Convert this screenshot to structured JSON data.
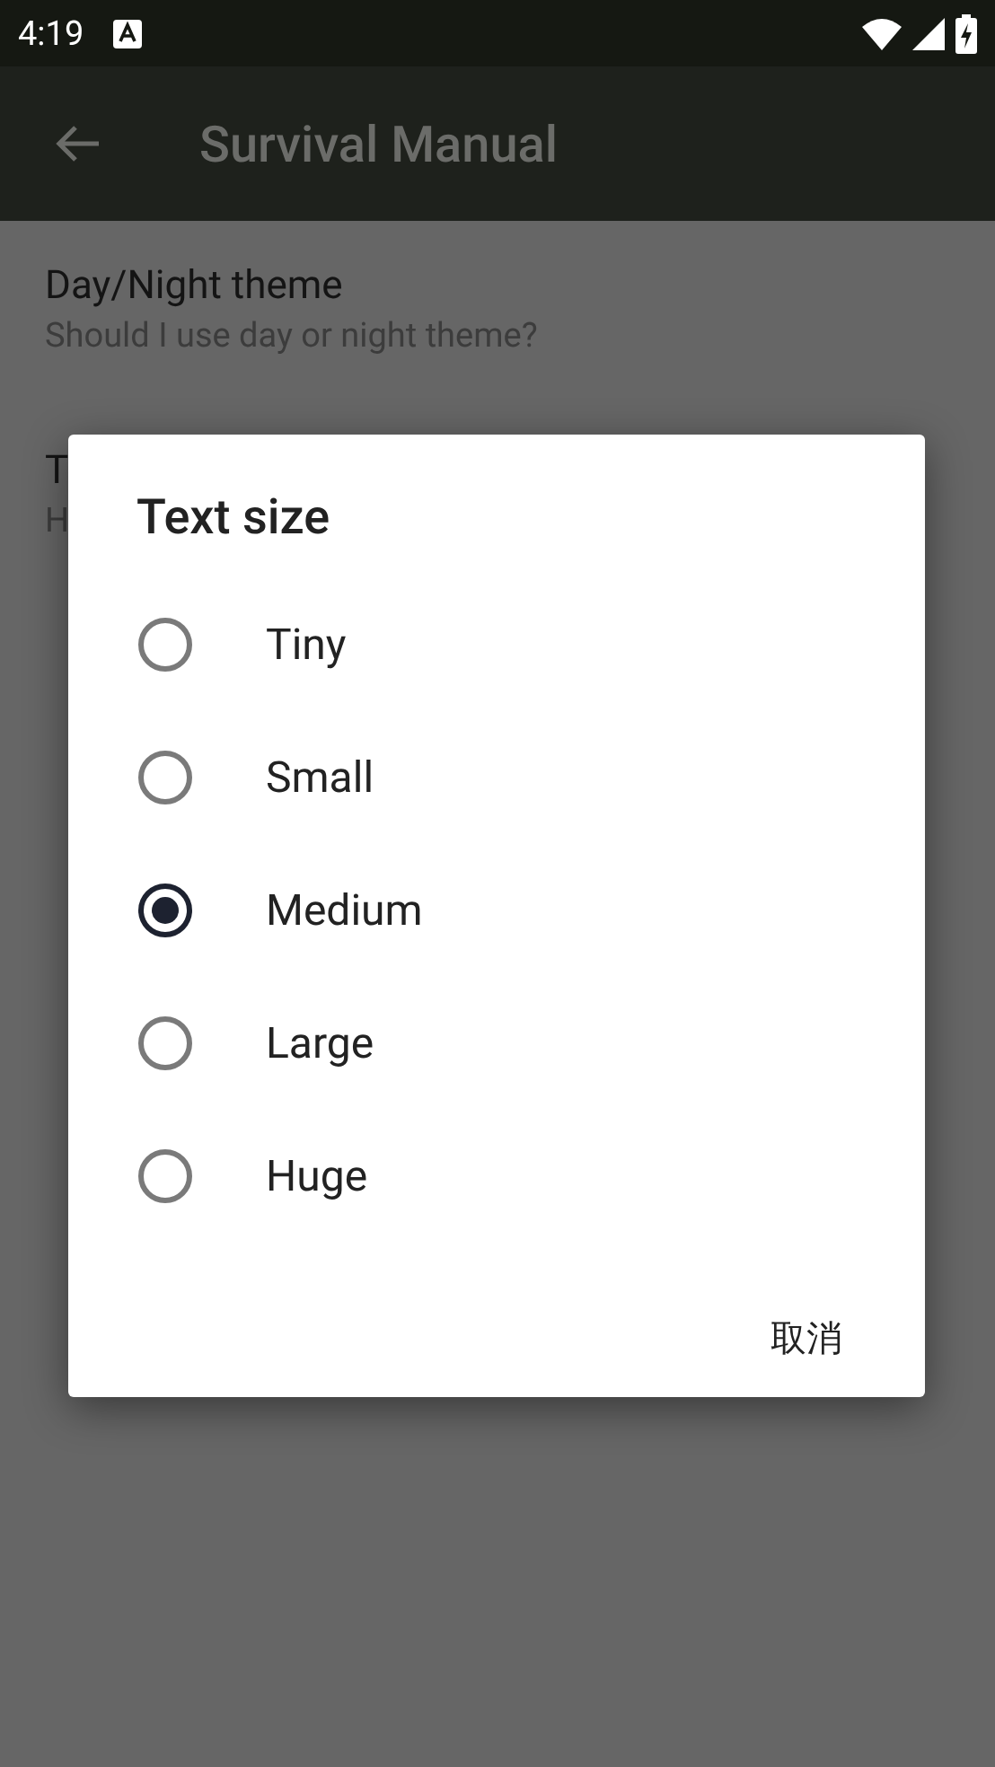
{
  "status_bar": {
    "time": "4:19"
  },
  "app_bar": {
    "title": "Survival Manual"
  },
  "settings": [
    {
      "title": "Day/Night theme",
      "summary": "Should I use day or night theme?"
    },
    {
      "title": "T",
      "summary": "H"
    }
  ],
  "dialog": {
    "title": "Text size",
    "options": [
      {
        "label": "Tiny",
        "selected": false
      },
      {
        "label": "Small",
        "selected": false
      },
      {
        "label": "Medium",
        "selected": true
      },
      {
        "label": "Large",
        "selected": false
      },
      {
        "label": "Huge",
        "selected": false
      }
    ],
    "buttons": [
      "取消"
    ]
  }
}
